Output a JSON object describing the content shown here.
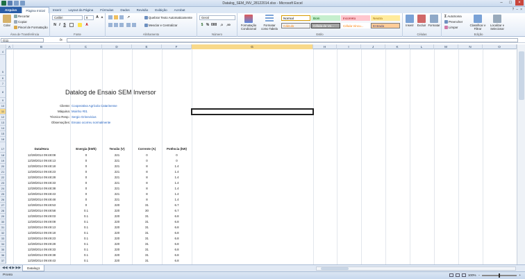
{
  "window": {
    "title": "Datalog_SEM_INV_28122014.xlsx - Microsoft Excel"
  },
  "tabs": [
    "Arquivo",
    "Página Inicial",
    "Inserir",
    "Layout da Página",
    "Fórmulas",
    "Dados",
    "Revisão",
    "Exibição",
    "Acrobat"
  ],
  "ribbon": {
    "clipboard": {
      "paste": "Colar",
      "cut": "Recortar",
      "copy": "Copiar",
      "painter": "Pincel de Formatação",
      "label": "Área de Transferência"
    },
    "font": {
      "name": "Calibri",
      "size": "8",
      "label": "Fonte"
    },
    "alignment": {
      "wrap": "Quebrar Texto Automaticamente",
      "merge": "Mesclar e Centralizar",
      "label": "Alinhamento"
    },
    "number": {
      "format": "Geral",
      "label": "Número"
    },
    "styles": {
      "cond": "Formatação Condicional",
      "table": "Formatar como Tabela",
      "items": [
        {
          "label": "Normal",
          "bg": "#ffffff",
          "fg": "#000000",
          "border": "#d79b00"
        },
        {
          "label": "Bom",
          "bg": "#c6efce",
          "fg": "#006100",
          "border": "#c6efce"
        },
        {
          "label": "Incorreto",
          "bg": "#ffc7ce",
          "fg": "#9c0006",
          "border": "#ffc7ce"
        },
        {
          "label": "Neutra",
          "bg": "#ffeb9c",
          "fg": "#9c6500",
          "border": "#ffeb9c"
        },
        {
          "label": "Cálculo",
          "bg": "#f2f2f2",
          "fg": "#fa7d00",
          "border": "#7f7f7f"
        },
        {
          "label": "Célula de Ve...",
          "bg": "#a5a5a5",
          "fg": "#ffffff",
          "border": "#3f3f3f"
        },
        {
          "label": "Célula Vincu...",
          "bg": "#ffffff",
          "fg": "#fa7d00",
          "border": "#ffffff"
        },
        {
          "label": "Entrada",
          "bg": "#ffcc99",
          "fg": "#3f3f76",
          "border": "#7f7f7f"
        }
      ],
      "label": "Estilo"
    },
    "cells": {
      "insert": "Inserir",
      "delete": "Excluir",
      "format": "Formatar",
      "label": "Células"
    },
    "editing": {
      "autosum": "AutoSoma",
      "fill": "Preencher",
      "clear": "Limpar",
      "sort": "Classificar e Filtrar",
      "find": "Localizar e Selecionar",
      "label": "Edição"
    }
  },
  "formula_bar": {
    "name_box": "G11",
    "fx": "fx",
    "value": ""
  },
  "columns": [
    "A",
    "B",
    "C",
    "D",
    "E",
    "F",
    "G",
    "H",
    "I",
    "J",
    "K",
    "L",
    "M",
    "N",
    "O"
  ],
  "selected_cell": {
    "col": "G",
    "row": "11"
  },
  "sheet": {
    "title": "Datalog de Ensaio SEM Inversor",
    "info": [
      {
        "row": "10",
        "label": "Cliente:",
        "value": "Cooperativa Agrícola Catarinense"
      },
      {
        "row": "11",
        "label": "Máquina:",
        "value": "Moinho #01"
      },
      {
        "row": "12",
        "label": "Técnico Resp.:",
        "value": "Sergio Grinevicius"
      },
      {
        "row": "13",
        "label": "Observações:",
        "value": "Ensaio ocorreu normalmente"
      }
    ],
    "headers": [
      "Data/Hora",
      "Energia (kWh)",
      "Tensão (V)",
      "Corrente (A)",
      "Potência (kW)"
    ],
    "data": [
      {
        "row": "18",
        "dt": "12/28/2014 09:48:08",
        "e": "0",
        "v": "221",
        "i": "0",
        "p": "0"
      },
      {
        "row": "19",
        "dt": "12/28/2014 09:48:13",
        "e": "0",
        "v": "221",
        "i": "0",
        "p": "0"
      },
      {
        "row": "20",
        "dt": "12/28/2014 09:48:18",
        "e": "0",
        "v": "221",
        "i": "8",
        "p": "1.4"
      },
      {
        "row": "21",
        "dt": "12/28/2014 09:48:23",
        "e": "0",
        "v": "221",
        "i": "8",
        "p": "1.4"
      },
      {
        "row": "22",
        "dt": "12/28/2014 09:48:28",
        "e": "0",
        "v": "221",
        "i": "8",
        "p": "1.4"
      },
      {
        "row": "23",
        "dt": "12/28/2014 09:48:33",
        "e": "0",
        "v": "221",
        "i": "8",
        "p": "1.4"
      },
      {
        "row": "24",
        "dt": "12/28/2014 09:48:38",
        "e": "0",
        "v": "221",
        "i": "8",
        "p": "1.4"
      },
      {
        "row": "25",
        "dt": "12/28/2014 09:48:43",
        "e": "0",
        "v": "221",
        "i": "8",
        "p": "1.4"
      },
      {
        "row": "26",
        "dt": "12/28/2014 09:48:48",
        "e": "0",
        "v": "221",
        "i": "8",
        "p": "1.4"
      },
      {
        "row": "27",
        "dt": "12/28/2014 09:48:53",
        "e": "0",
        "v": "220",
        "i": "31",
        "p": "6.7"
      },
      {
        "row": "28",
        "dt": "12/28/2014 09:48:58",
        "e": "0.1",
        "v": "220",
        "i": "30",
        "p": "6.7"
      },
      {
        "row": "29",
        "dt": "12/28/2014 09:49:03",
        "e": "0.1",
        "v": "220",
        "i": "31",
        "p": "6.8"
      },
      {
        "row": "30",
        "dt": "12/28/2014 09:49:08",
        "e": "0.1",
        "v": "220",
        "i": "31",
        "p": "6.8"
      },
      {
        "row": "31",
        "dt": "12/28/2014 09:49:13",
        "e": "0.1",
        "v": "220",
        "i": "31",
        "p": "6.8"
      },
      {
        "row": "32",
        "dt": "12/28/2014 09:49:18",
        "e": "0.1",
        "v": "220",
        "i": "31",
        "p": "6.8"
      },
      {
        "row": "33",
        "dt": "12/28/2014 09:49:23",
        "e": "0.1",
        "v": "220",
        "i": "31",
        "p": "6.8"
      },
      {
        "row": "34",
        "dt": "12/28/2014 09:49:28",
        "e": "0.1",
        "v": "220",
        "i": "31",
        "p": "6.8"
      },
      {
        "row": "35",
        "dt": "12/28/2014 09:49:33",
        "e": "0.1",
        "v": "220",
        "i": "31",
        "p": "6.8"
      },
      {
        "row": "36",
        "dt": "12/28/2014 09:49:38",
        "e": "0.1",
        "v": "220",
        "i": "31",
        "p": "6.8"
      },
      {
        "row": "37",
        "dt": "12/28/2014 09:49:43",
        "e": "0.1",
        "v": "220",
        "i": "31",
        "p": "6.8"
      }
    ]
  },
  "sheet_tabs": [
    "Datalog1"
  ],
  "status": {
    "text": "Pronto",
    "zoom": "100%"
  }
}
